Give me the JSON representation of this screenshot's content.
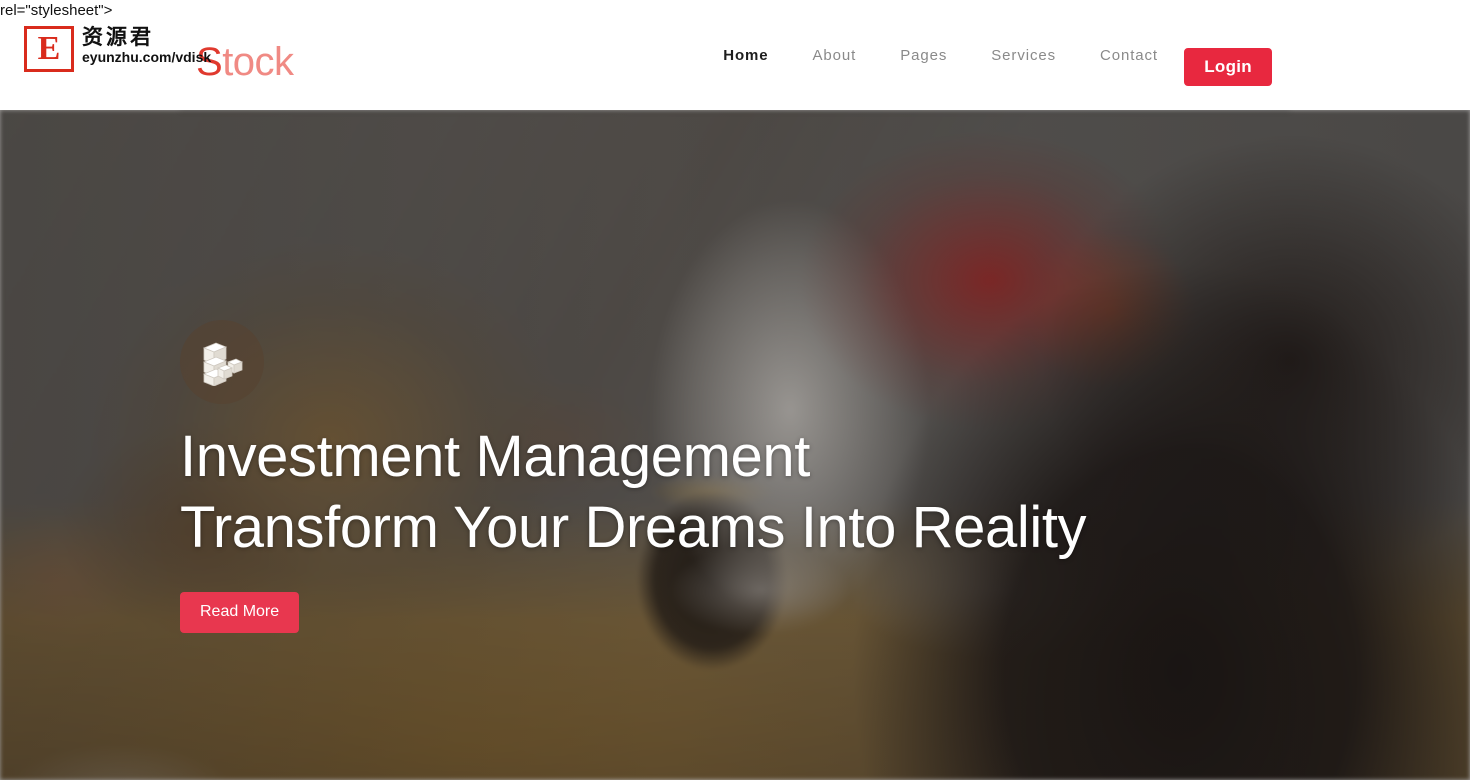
{
  "page": {
    "code_leak_text": "rel=\"stylesheet\">"
  },
  "watermark": {
    "badge_letter": "E",
    "chinese_text": "资源君",
    "url_text": "eyunzhu.com/vdisk"
  },
  "header": {
    "brand": {
      "first_letter": "S",
      "rest": "tock"
    },
    "nav": [
      {
        "label": "Home",
        "active": true
      },
      {
        "label": "About",
        "active": false
      },
      {
        "label": "Pages",
        "active": false
      },
      {
        "label": "Services",
        "active": false
      },
      {
        "label": "Contact",
        "active": false
      }
    ],
    "login_label": "Login"
  },
  "hero": {
    "badge_icon": "stacked-cubes-icon",
    "title_line1": "Investment Management",
    "title_line2": "Transform Your Dreams Into Reality",
    "cta_label": "Read More"
  },
  "colors": {
    "brand_red": "#e0392e",
    "brand_light": "#f08a84",
    "login_red": "#e8283f",
    "cta_red": "#e8374f",
    "nav_inactive": "#8a8a8a",
    "nav_active": "#1d1d1d",
    "watermark_red": "#d92b1c"
  }
}
